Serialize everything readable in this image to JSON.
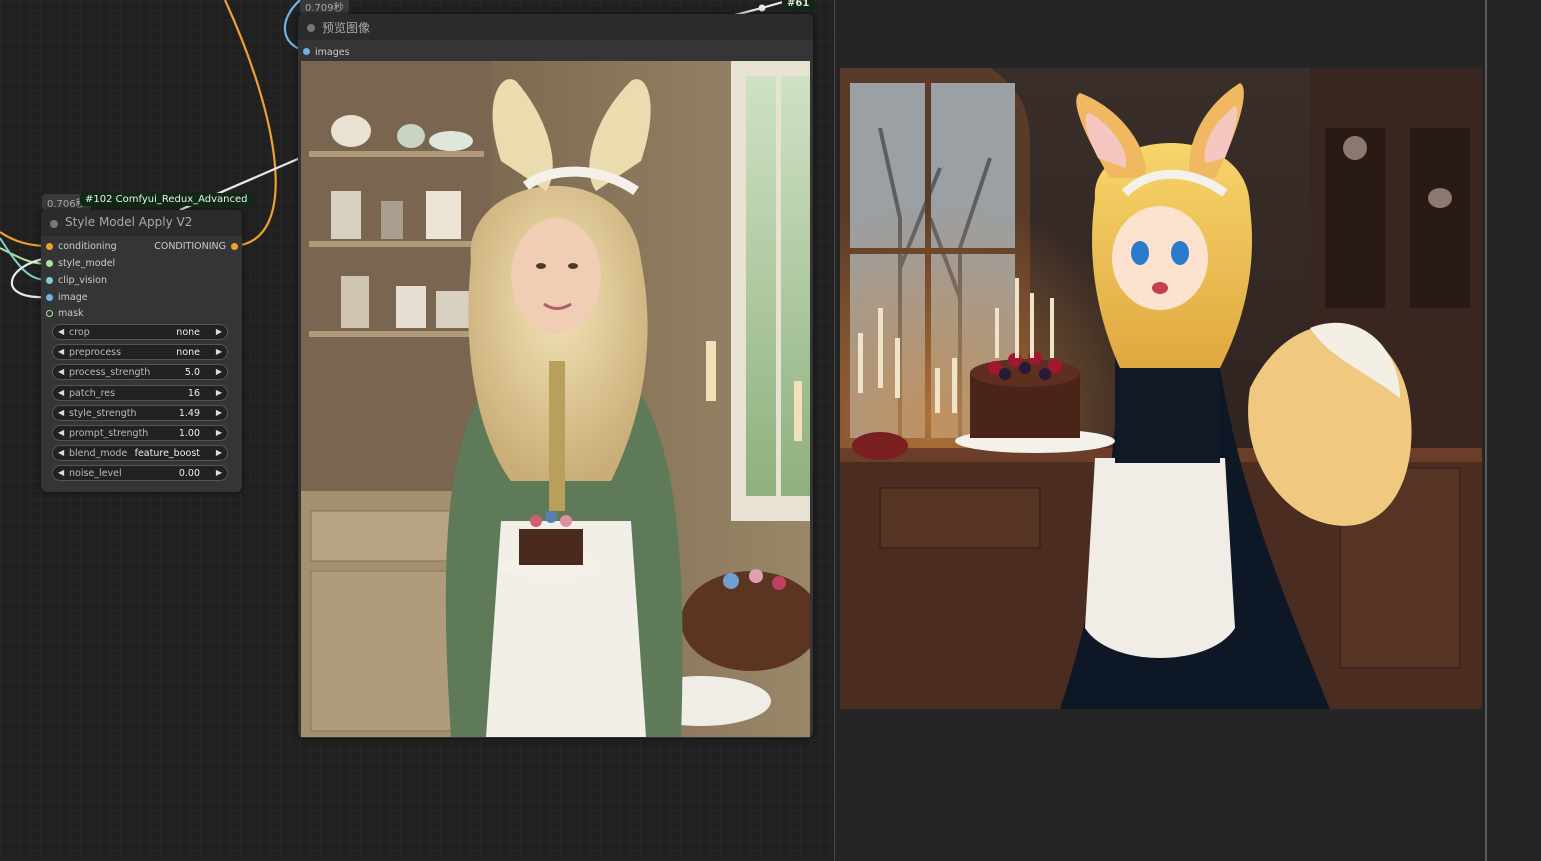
{
  "redux_node": {
    "time": "0.706秒",
    "tag": "#102 Comfyui_Redux_Advanced",
    "title": "Style Model Apply V2",
    "inputs": [
      "conditioning",
      "style_model",
      "clip_vision",
      "image",
      "mask"
    ],
    "output": "CONDITIONING",
    "widgets": [
      {
        "name": "crop",
        "value": "none"
      },
      {
        "name": "preprocess",
        "value": "none"
      },
      {
        "name": "process_strength",
        "value": "5.0"
      },
      {
        "name": "patch_res",
        "value": "16"
      },
      {
        "name": "style_strength",
        "value": "1.49"
      },
      {
        "name": "prompt_strength",
        "value": "1.00"
      },
      {
        "name": "blend_mode",
        "value": "feature_boost"
      },
      {
        "name": "noise_level",
        "value": "0.00"
      }
    ]
  },
  "preview_node": {
    "time": "0.709秒",
    "title": "预览图像",
    "input": "images"
  },
  "node_tag_61": "#61",
  "colors": {
    "conditioning_wire": "#f0a030",
    "clip_wire": "#6fb3e8",
    "style_wire": "#a8e6a0",
    "image_wire": "#6fb3e8",
    "canvas_bg": "#202020"
  },
  "images": {
    "left_preview": "woman in green maid dress with fluffy ears holding cake",
    "right_reference": "anime fox girl maid holding berry cake"
  }
}
